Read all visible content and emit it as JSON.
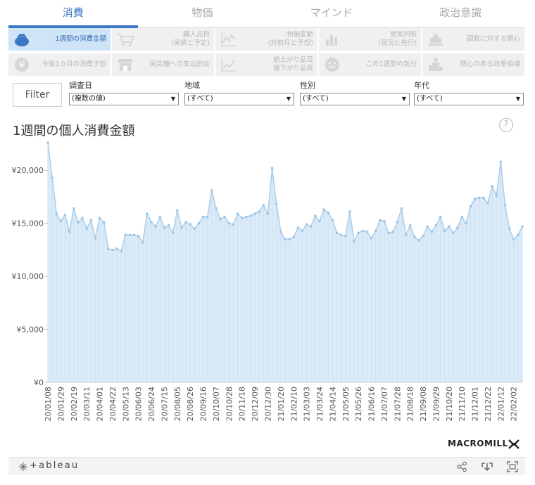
{
  "tabs": [
    {
      "label": "消費",
      "active": true
    },
    {
      "label": "物価",
      "active": false
    },
    {
      "label": "マインド",
      "active": false
    },
    {
      "label": "政治意識",
      "active": false
    }
  ],
  "subnav": [
    {
      "lines": [
        "1週間の消費金額"
      ],
      "icon": "purse-icon",
      "active": true
    },
    {
      "lines": [
        "購入品目",
        "(実績と予定)"
      ],
      "icon": "cart-icon"
    },
    {
      "lines": [
        "物価変動",
        "(対前月と予想)"
      ],
      "icon": "line-chart-icon"
    },
    {
      "lines": [
        "景気判断",
        "(現況と先行)"
      ],
      "icon": "bar-chart-icon"
    },
    {
      "lines": [
        "国政に対する関心"
      ],
      "icon": "parliament-icon"
    },
    {
      "lines": [
        "今後1カ月の消費予想"
      ],
      "icon": "yen-icon"
    },
    {
      "lines": [
        "実店舗への支出割合"
      ],
      "icon": "store-icon"
    },
    {
      "lines": [
        "値上がり品目",
        "値下がり品目"
      ],
      "icon": "trend-up-icon"
    },
    {
      "lines": [
        "この1週間の気分"
      ],
      "icon": "smile-icon"
    },
    {
      "lines": [
        "関心のある政策領域"
      ],
      "icon": "podium-icon"
    }
  ],
  "filter_button": "Filter",
  "filters": [
    {
      "label": "調査日",
      "value": "(複数の値)"
    },
    {
      "label": "地域",
      "value": "(すべて)"
    },
    {
      "label": "性別",
      "value": "(すべて)"
    },
    {
      "label": "年代",
      "value": "(すべて)"
    }
  ],
  "help_label": "?",
  "brand": "MACROMILL",
  "footer": {
    "logo": "+ableau"
  },
  "colors": {
    "accent": "#3a78c3",
    "area_fill": "#cfe3f4",
    "line": "#a9cdea",
    "point": "#9cc6e8"
  },
  "chart_data": {
    "type": "area",
    "title": "1週間の個人消費金額",
    "xlabel": "",
    "ylabel": "",
    "ylim": [
      0,
      22800
    ],
    "y_ticks": [
      "¥0",
      "¥5,000",
      "¥10,000",
      "¥15,000",
      "¥20,000"
    ],
    "y_tick_values": [
      0,
      5000,
      10000,
      15000,
      20000
    ],
    "x_tick_labels": [
      "20/01/08",
      "20/01/29",
      "20/02/19",
      "20/03/11",
      "20/04/01",
      "20/04/22",
      "20/05/13",
      "20/06/03",
      "20/06/24",
      "20/07/15",
      "20/08/05",
      "20/08/26",
      "20/09/16",
      "20/10/07",
      "20/10/28",
      "20/11/18",
      "20/12/09",
      "20/12/30",
      "21/01/20",
      "21/02/10",
      "21/03/03",
      "21/03/24",
      "21/04/14",
      "21/05/05",
      "21/05/26",
      "21/06/16",
      "21/07/07",
      "21/07/28",
      "21/08/18",
      "21/09/08",
      "21/09/29",
      "21/10/20",
      "21/11/10",
      "21/12/01",
      "21/12/22",
      "22/01/12",
      "22/02/02"
    ],
    "values": [
      22600,
      19300,
      15900,
      15200,
      15800,
      14200,
      16400,
      15100,
      15500,
      14500,
      15300,
      13600,
      15500,
      15100,
      12600,
      12500,
      12600,
      12400,
      13900,
      13900,
      13900,
      13800,
      13200,
      15900,
      15100,
      14700,
      15600,
      14600,
      14800,
      14100,
      16200,
      14600,
      15100,
      14900,
      14500,
      15000,
      15600,
      15600,
      18100,
      16400,
      15400,
      15600,
      15000,
      14900,
      15900,
      15500,
      15600,
      15700,
      15900,
      16100,
      16700,
      15900,
      20200,
      16800,
      14200,
      13500,
      13500,
      13700,
      14600,
      14300,
      14900,
      14700,
      15700,
      15200,
      16300,
      16000,
      15300,
      14100,
      13900,
      13800,
      16100,
      13300,
      14100,
      14300,
      14200,
      13600,
      14300,
      15300,
      15200,
      14100,
      14200,
      15100,
      16400,
      13900,
      14800,
      13700,
      13400,
      13800,
      14700,
      14200,
      14800,
      15600,
      14300,
      14700,
      14100,
      14600,
      15600,
      15000,
      16600,
      17300,
      17400,
      17400,
      16900,
      18500,
      17600,
      20800,
      16700,
      14500,
      13500,
      13900,
      14700
    ]
  }
}
